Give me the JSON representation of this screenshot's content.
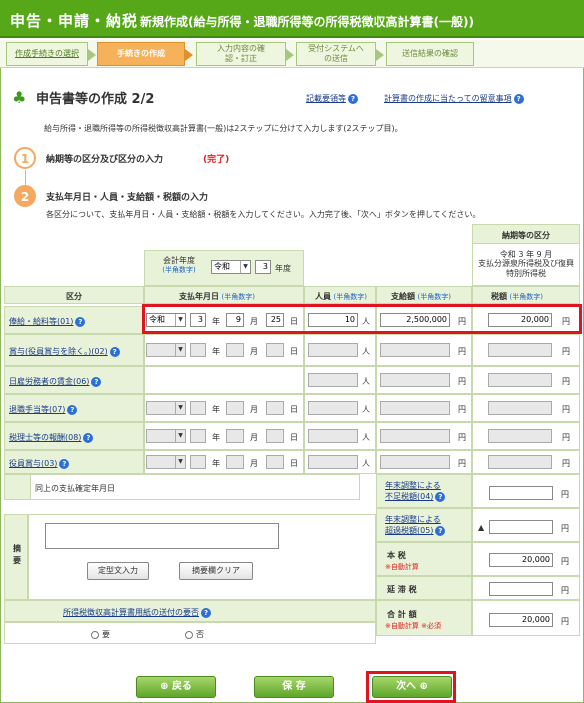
{
  "header": {
    "section": "申告・申請・納税",
    "form_title": "新規作成(給与所得・退職所得等の所得税徴収高計算書(一般))"
  },
  "steps": [
    "作成手続きの選択",
    "手続きの作成",
    "入力内容の確認・訂正",
    "受付システムへの送信",
    "送信結果の確認"
  ],
  "page": {
    "title": "申告書等の作成 2/2",
    "link_help": "記載要領等",
    "link_notes": "計算書の作成に当たっての留意事項",
    "intro": "給与所得・退職所得等の所得税徴収高計算書(一般)は2ステップに分けて入力します(2ステップ目)。",
    "step1_title": "納期等の区分及び区分の入力",
    "step1_status": "(完了)",
    "step2_title": "支払年月日・人員・支給額・税額の入力",
    "step2_desc": "各区分について、支払年月日・人員・支給額・税額を入力してください。入力完了後、「次へ」ボタンを押してください。"
  },
  "table": {
    "period_header": "納期等の区分",
    "period_value": "令和 3 年 9 月",
    "period_type": "支払分源泉所得税及び復興特別所得税",
    "fy_label": "会計年度",
    "fy_sub": "(半角数字)",
    "fy_era": "令和",
    "fy_year": "3",
    "fy_unit": "年度",
    "col_kubun": "区分",
    "col_date": "支払年月日",
    "col_date_sub": "(半角数字)",
    "col_people": "人員",
    "col_people_sub": "(半角数字)",
    "col_amount": "支給額",
    "col_amount_sub": "(半角数字)",
    "col_tax": "税額",
    "col_tax_sub": "(半角数字)",
    "unit_year": "年",
    "unit_month": "月",
    "unit_day": "日",
    "unit_person": "人",
    "unit_yen": "円",
    "rows": [
      {
        "label": "俸給・給料等(01)",
        "era": "令和",
        "y": "3",
        "m": "9",
        "d": "25",
        "people": "10",
        "amount": "2,500,000",
        "tax": "20,000"
      },
      {
        "label": "賞与(役員賞与を除く。)(02)",
        "era": "",
        "y": "",
        "m": "",
        "d": "",
        "people": "",
        "amount": "",
        "tax": ""
      },
      {
        "label": "日雇労務者の賃金(06)",
        "era": "",
        "y": "",
        "m": "",
        "d": "",
        "people": "",
        "amount": "",
        "tax": ""
      },
      {
        "label": "退職手当等(07)",
        "era": "",
        "y": "",
        "m": "",
        "d": "",
        "people": "",
        "amount": "",
        "tax": ""
      },
      {
        "label": "税理士等の報酬(08)",
        "era": "",
        "y": "",
        "m": "",
        "d": "",
        "people": "",
        "amount": "",
        "tax": ""
      },
      {
        "label": "役員賞与(03)",
        "era": "",
        "y": "",
        "m": "",
        "d": "",
        "people": "",
        "amount": "",
        "tax": ""
      }
    ],
    "same_day_label": "同上の支払確定年月日",
    "ye_short_1": "年末調整による",
    "ye_short_2": "不足税額(04)",
    "ye_over_1": "年末調整による",
    "ye_over_2": "超過税額(05)",
    "triangle": "▲",
    "honzei": "本 税",
    "auto_calc": "※自動計算",
    "honzei_val": "20,000",
    "entai": "延 滞 税",
    "total": "合 計 額",
    "total_note": "※自動計算 ※必須",
    "total_val": "20,000",
    "tekiyo": "摘 要",
    "btn_fixed": "定型文入力",
    "btn_clear": "摘要欄クリア",
    "send_q": "所得税徴収高計算書用紙の送付の要否",
    "yes": "要",
    "no": "否"
  },
  "buttons": {
    "back": "戻る",
    "save": "保 存",
    "next": "次へ"
  }
}
